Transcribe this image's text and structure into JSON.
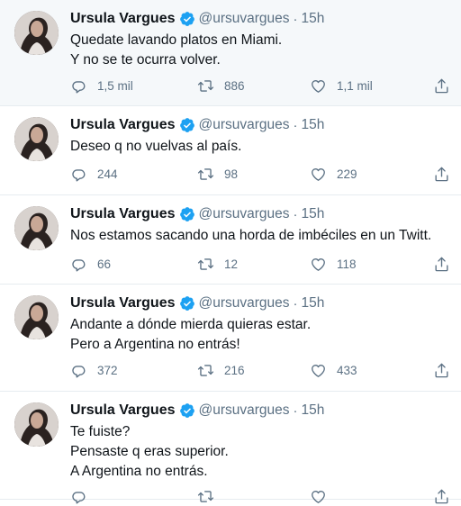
{
  "user": {
    "name": "Ursula Vargues",
    "handle": "@ursuvargues",
    "time": "15h"
  },
  "tweets": [
    {
      "lines": [
        "Quedate lavando platos en Miami.",
        "Y no se te ocurra volver."
      ],
      "replies": "1,5 mil",
      "retweets": "886",
      "likes": "1,1 mil"
    },
    {
      "lines": [
        "Deseo q no vuelvas al país."
      ],
      "replies": "244",
      "retweets": "98",
      "likes": "229"
    },
    {
      "lines": [
        "Nos estamos sacando una horda de imbéciles en un Twitt."
      ],
      "replies": "66",
      "retweets": "12",
      "likes": "118"
    },
    {
      "lines": [
        "Andante a dónde mierda quieras estar.",
        "Pero a Argentina no entrás!"
      ],
      "replies": "372",
      "retweets": "216",
      "likes": "433"
    },
    {
      "lines": [
        "Te fuiste?",
        "Pensaste q eras superior.",
        "A Argentina no entrás."
      ],
      "replies": "",
      "retweets": "",
      "likes": ""
    }
  ],
  "colors": {
    "verified": "#1da1f2",
    "muted": "#5b7083",
    "text": "#0f1419",
    "divider": "#e6ecf0"
  },
  "icons": [
    "reply-icon",
    "retweet-icon",
    "like-icon",
    "share-icon",
    "verified-badge-icon"
  ]
}
